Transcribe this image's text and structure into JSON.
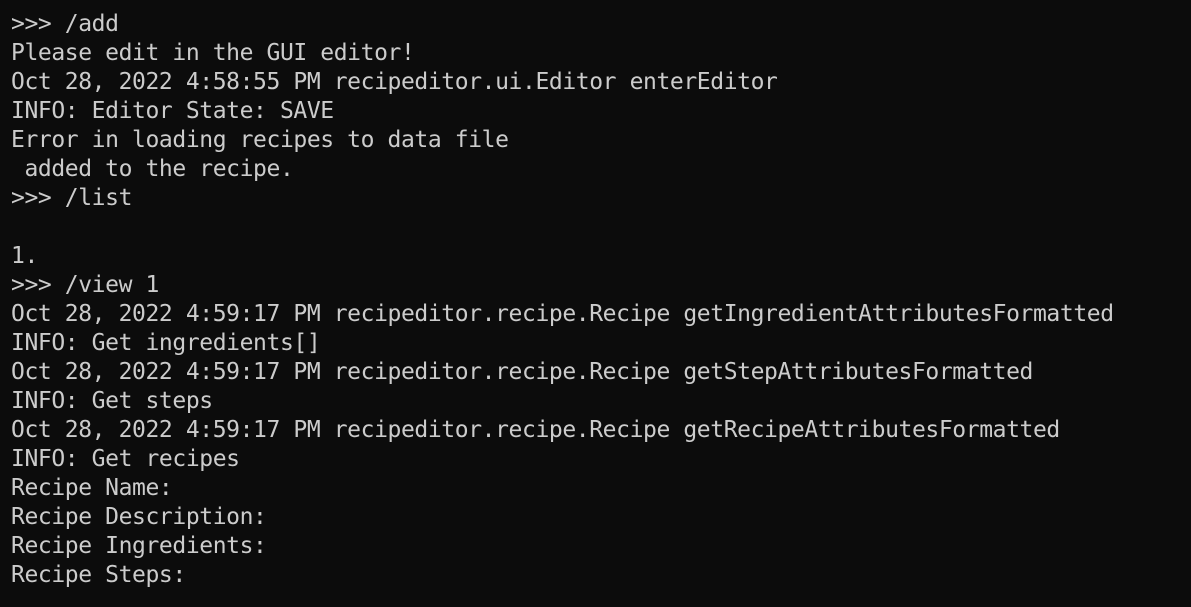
{
  "terminal": {
    "foreground": "#cccccc",
    "background": "#0c0c0c",
    "lines": [
      ">>> /add",
      "Please edit in the GUI editor!",
      "Oct 28, 2022 4:58:55 PM recipeditor.ui.Editor enterEditor",
      "INFO: Editor State: SAVE",
      "Error in loading recipes to data file",
      " added to the recipe.",
      ">>> /list",
      "",
      "1.",
      ">>> /view 1",
      "Oct 28, 2022 4:59:17 PM recipeditor.recipe.Recipe getIngredientAttributesFormatted",
      "INFO: Get ingredients[]",
      "Oct 28, 2022 4:59:17 PM recipeditor.recipe.Recipe getStepAttributesFormatted",
      "INFO: Get steps",
      "Oct 28, 2022 4:59:17 PM recipeditor.recipe.Recipe getRecipeAttributesFormatted",
      "INFO: Get recipes",
      "Recipe Name:",
      "Recipe Description:",
      "Recipe Ingredients:",
      "Recipe Steps:"
    ]
  }
}
